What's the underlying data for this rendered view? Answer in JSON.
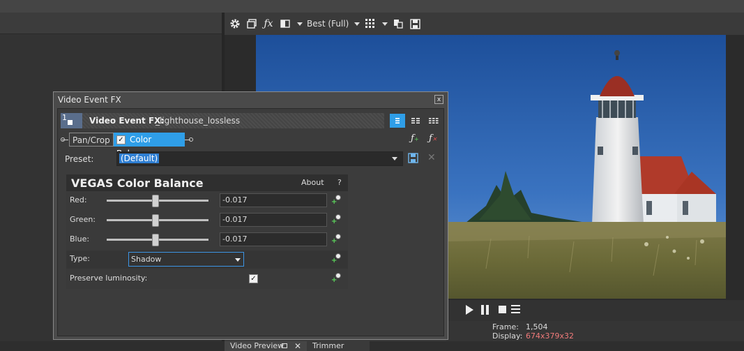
{
  "toolbar": {
    "quality_label": "Best (Full)",
    "icons": [
      "gear-icon",
      "preview-icon",
      "fx-icon",
      "split-screen-icon",
      "grid-icon",
      "copy-snapshot-icon",
      "save-snapshot-icon"
    ]
  },
  "dialog": {
    "title": "Video Event FX",
    "close_label": "x",
    "chain_number": "1",
    "chain_label": "Video Event FX:",
    "chain_name": "_lighthouse_lossless",
    "plugins": [
      "Pan/Crop",
      "Color Balance"
    ],
    "preset_label": "Preset:",
    "preset_value": "(Default)",
    "plugin_title": "VEGAS Color Balance",
    "about_label": "About",
    "help_label": "?",
    "params": [
      {
        "label": "Red:",
        "value": "-0.017",
        "slider_fraction": 0.48
      },
      {
        "label": "Green:",
        "value": "-0.017",
        "slider_fraction": 0.48
      },
      {
        "label": "Blue:",
        "value": "-0.017",
        "slider_fraction": 0.48
      }
    ],
    "type_label": "Type:",
    "type_value": "Shadow",
    "preserve_label": "Preserve luminosity:",
    "preserve_checked": true
  },
  "status": {
    "frame_label": "Frame:",
    "frame_value": "1,504",
    "display_label": "Display:",
    "display_value": "674x379x32"
  },
  "bottom_tabs": {
    "preview_label": "Video Preview",
    "trimmer_label": "Trimmer"
  },
  "colors": {
    "accent": "#2f9ee8",
    "display_value": "#f07a7a"
  }
}
